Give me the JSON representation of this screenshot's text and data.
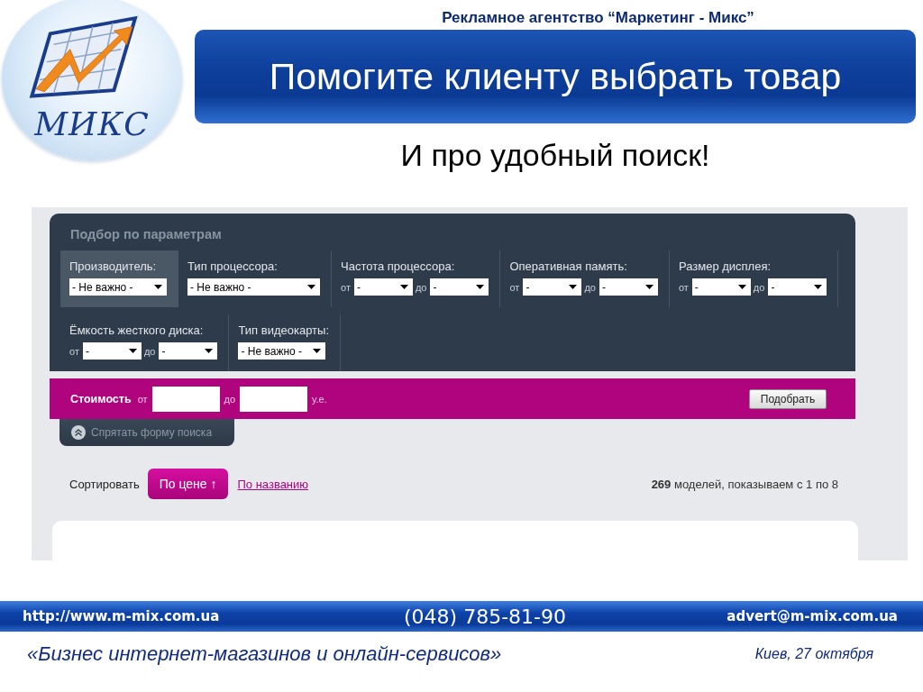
{
  "header": {
    "logo_text": "МИКС",
    "agency": "Рекламное агентство “Маркетинг - Микс”",
    "title": "Помогите клиенту выбрать товар",
    "subtitle": "И про удобный поиск!"
  },
  "search_form": {
    "title": "Подбор по параметрам",
    "filter_rows": [
      [
        {
          "label": "Производитель:",
          "kind": "single",
          "value": "- Не важно -",
          "selected": true
        },
        {
          "label": "Тип процессора:",
          "kind": "single",
          "value": "- Не важно -",
          "selected": false
        },
        {
          "label": "Частота процессора:",
          "kind": "range",
          "from_label": "от",
          "from_value": "-",
          "to_label": "до",
          "to_value": "-",
          "selected": false
        },
        {
          "label": "Оперативная память:",
          "kind": "range",
          "from_label": "от",
          "from_value": "-",
          "to_label": "до",
          "to_value": "-",
          "selected": false
        },
        {
          "label": "Размер дисплея:",
          "kind": "range",
          "from_label": "от",
          "from_value": "-",
          "to_label": "до",
          "to_value": "-",
          "selected": false
        }
      ],
      [
        {
          "label": "Ёмкость жесткого диска:",
          "kind": "range",
          "from_label": "от",
          "from_value": "-",
          "to_label": "до",
          "to_value": "-",
          "selected": false
        },
        {
          "label": "Тип видеокарты:",
          "kind": "single",
          "value": "- Не важно -",
          "selected": false
        }
      ]
    ],
    "price": {
      "label": "Стоимость",
      "from_label": "от",
      "to_label": "до",
      "currency": "у.е."
    },
    "submit": "Подобрать",
    "hide_link": "Спрятать форму поиска"
  },
  "sorting": {
    "label": "Сортировать",
    "options": [
      {
        "label": "По цене ↑",
        "selected": true
      },
      {
        "label": "По названию",
        "selected": false
      }
    ],
    "results_count": "**269** моделей, показываем с 1 по 8"
  },
  "footer": {
    "website": "http://www.m-mix.com.ua",
    "phone": "(048) 785-81-90",
    "email": "advert@m-mix.com.ua",
    "event": "«Бизнес интернет-магазинов и онлайн-сервисов»",
    "place_date": "Киев, 27 октября"
  }
}
